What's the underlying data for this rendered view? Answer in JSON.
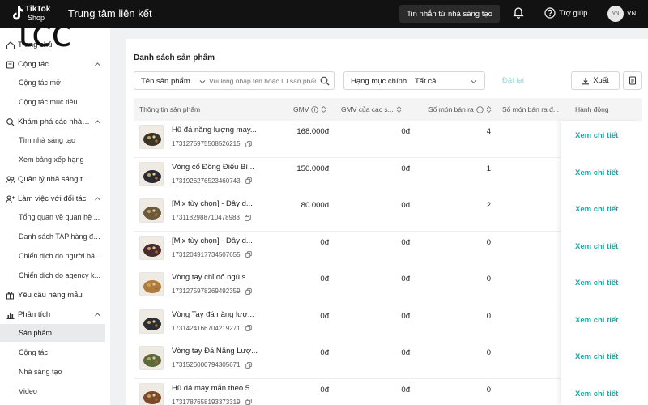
{
  "header": {
    "brand_tiktok": "TikTok",
    "brand_shop": "Shop",
    "title": "Trung tâm liên kết",
    "creator_messages_button": "Tin nhắn từ nhà sáng tạo",
    "help_label": "Trợ giúp",
    "avatar_initials": "VN",
    "avatar_label": "VN"
  },
  "watermark": "tcc",
  "sidebar": {
    "items": [
      {
        "type": "main",
        "icon": "home-icon",
        "label": "Trang chủ",
        "chevron": false
      },
      {
        "type": "main",
        "icon": "cooperation-icon",
        "label": "Cộng tác",
        "chevron": true
      },
      {
        "type": "sub",
        "label": "Cộng tác mở"
      },
      {
        "type": "sub",
        "label": "Cộng tác mục tiêu"
      },
      {
        "type": "main",
        "icon": "explore-icon",
        "label": "Khám phá các nhà s...",
        "chevron": true
      },
      {
        "type": "sub",
        "label": "Tìm nhà sáng tạo"
      },
      {
        "type": "sub",
        "label": "Xem bảng xếp hạng"
      },
      {
        "type": "main",
        "icon": "users-icon",
        "label": "Quản lý nhà sáng tạo",
        "chevron": false
      },
      {
        "type": "main",
        "icon": "partner-icon",
        "label": "Làm việc với đối tác",
        "chevron": true
      },
      {
        "type": "sub",
        "label": "Tổng quan về quan hệ ..."
      },
      {
        "type": "sub",
        "label": "Danh sách TAP hàng đầu"
      },
      {
        "type": "sub",
        "label": "Chiến dịch do người bá..."
      },
      {
        "type": "sub",
        "label": "Chiến dịch do agency k..."
      },
      {
        "type": "main",
        "icon": "gift-icon",
        "label": "Yêu cầu hàng mẫu",
        "chevron": false
      },
      {
        "type": "main",
        "icon": "chart-icon",
        "label": "Phân tích",
        "chevron": true
      },
      {
        "type": "sub",
        "label": "Sản phẩm",
        "active": true
      },
      {
        "type": "sub",
        "label": "Cộng tác"
      },
      {
        "type": "sub",
        "label": "Nhà sáng tạo"
      },
      {
        "type": "sub",
        "label": "Video"
      }
    ]
  },
  "main": {
    "section_title": "Danh sách sản phẩm",
    "search": {
      "field_label": "Tên sản phẩm",
      "placeholder": "Vui lòng nhập tên hoặc ID sản phẩm"
    },
    "category": {
      "label": "Hạng mục chính",
      "value": "Tất cả"
    },
    "reset_label": "Đặt lại",
    "export_label": "Xuất",
    "columns": {
      "info": "Thông tin sản phẩm",
      "gmv": "GMV",
      "gmv_creators": "GMV của các s...",
      "items_sold": "Số món bán ra",
      "items_sold_2": "Số món bán ra đ...",
      "action": "Hành động"
    },
    "rows": [
      {
        "name": "Hũ đá năng lượng may...",
        "id": "1731275975508526215",
        "gmv": "168.000đ",
        "gmv_creators": "0đ",
        "sold": "4",
        "action": "Xem chi tiết",
        "thumb_color": "#3a3328"
      },
      {
        "name": "Vòng cổ Đồng Điếu Bì...",
        "id": "1731926276523460743",
        "gmv": "150.000đ",
        "gmv_creators": "0đ",
        "sold": "1",
        "action": "Xem chi tiết",
        "thumb_color": "#2a2a30"
      },
      {
        "name": "[Mix tùy chọn] - Dây d...",
        "id": "1731182988710478983",
        "gmv": "80.000đ",
        "gmv_creators": "0đ",
        "sold": "2",
        "action": "Xem chi tiết",
        "thumb_color": "#6b5a3c"
      },
      {
        "name": "[Mix tùy chọn] - Dây d...",
        "id": "1731204917734507655",
        "gmv": "0đ",
        "gmv_creators": "0đ",
        "sold": "0",
        "action": "Xem chi tiết",
        "thumb_color": "#4a2a2e"
      },
      {
        "name": "Vòng tay chỉ đỏ ngũ s...",
        "id": "1731275978269492359",
        "gmv": "0đ",
        "gmv_creators": "0đ",
        "sold": "0",
        "action": "Xem chi tiết",
        "thumb_color": "#b07a3a"
      },
      {
        "name": "Vòng Tay đá năng lượ...",
        "id": "1731424166704219271",
        "gmv": "0đ",
        "gmv_creators": "0đ",
        "sold": "0",
        "action": "Xem chi tiết",
        "thumb_color": "#2d2d34"
      },
      {
        "name": "Vòng tay Đá Năng Lượ...",
        "id": "1731526000794305671",
        "gmv": "0đ",
        "gmv_creators": "0đ",
        "sold": "0",
        "action": "Xem chi tiết",
        "thumb_color": "#5b6a3a"
      },
      {
        "name": "Hũ đá may mắn theo 5...",
        "id": "1731787658193373319",
        "gmv": "0đ",
        "gmv_creators": "0đ",
        "sold": "0",
        "action": "Xem chi tiết",
        "thumb_color": "#7a4a2a"
      }
    ]
  },
  "colors": {
    "topbar": "#121212",
    "accent_teal": "#17a9a3",
    "reset_disabled": "#9bd8d6",
    "active_nav": "#e9eaec"
  }
}
